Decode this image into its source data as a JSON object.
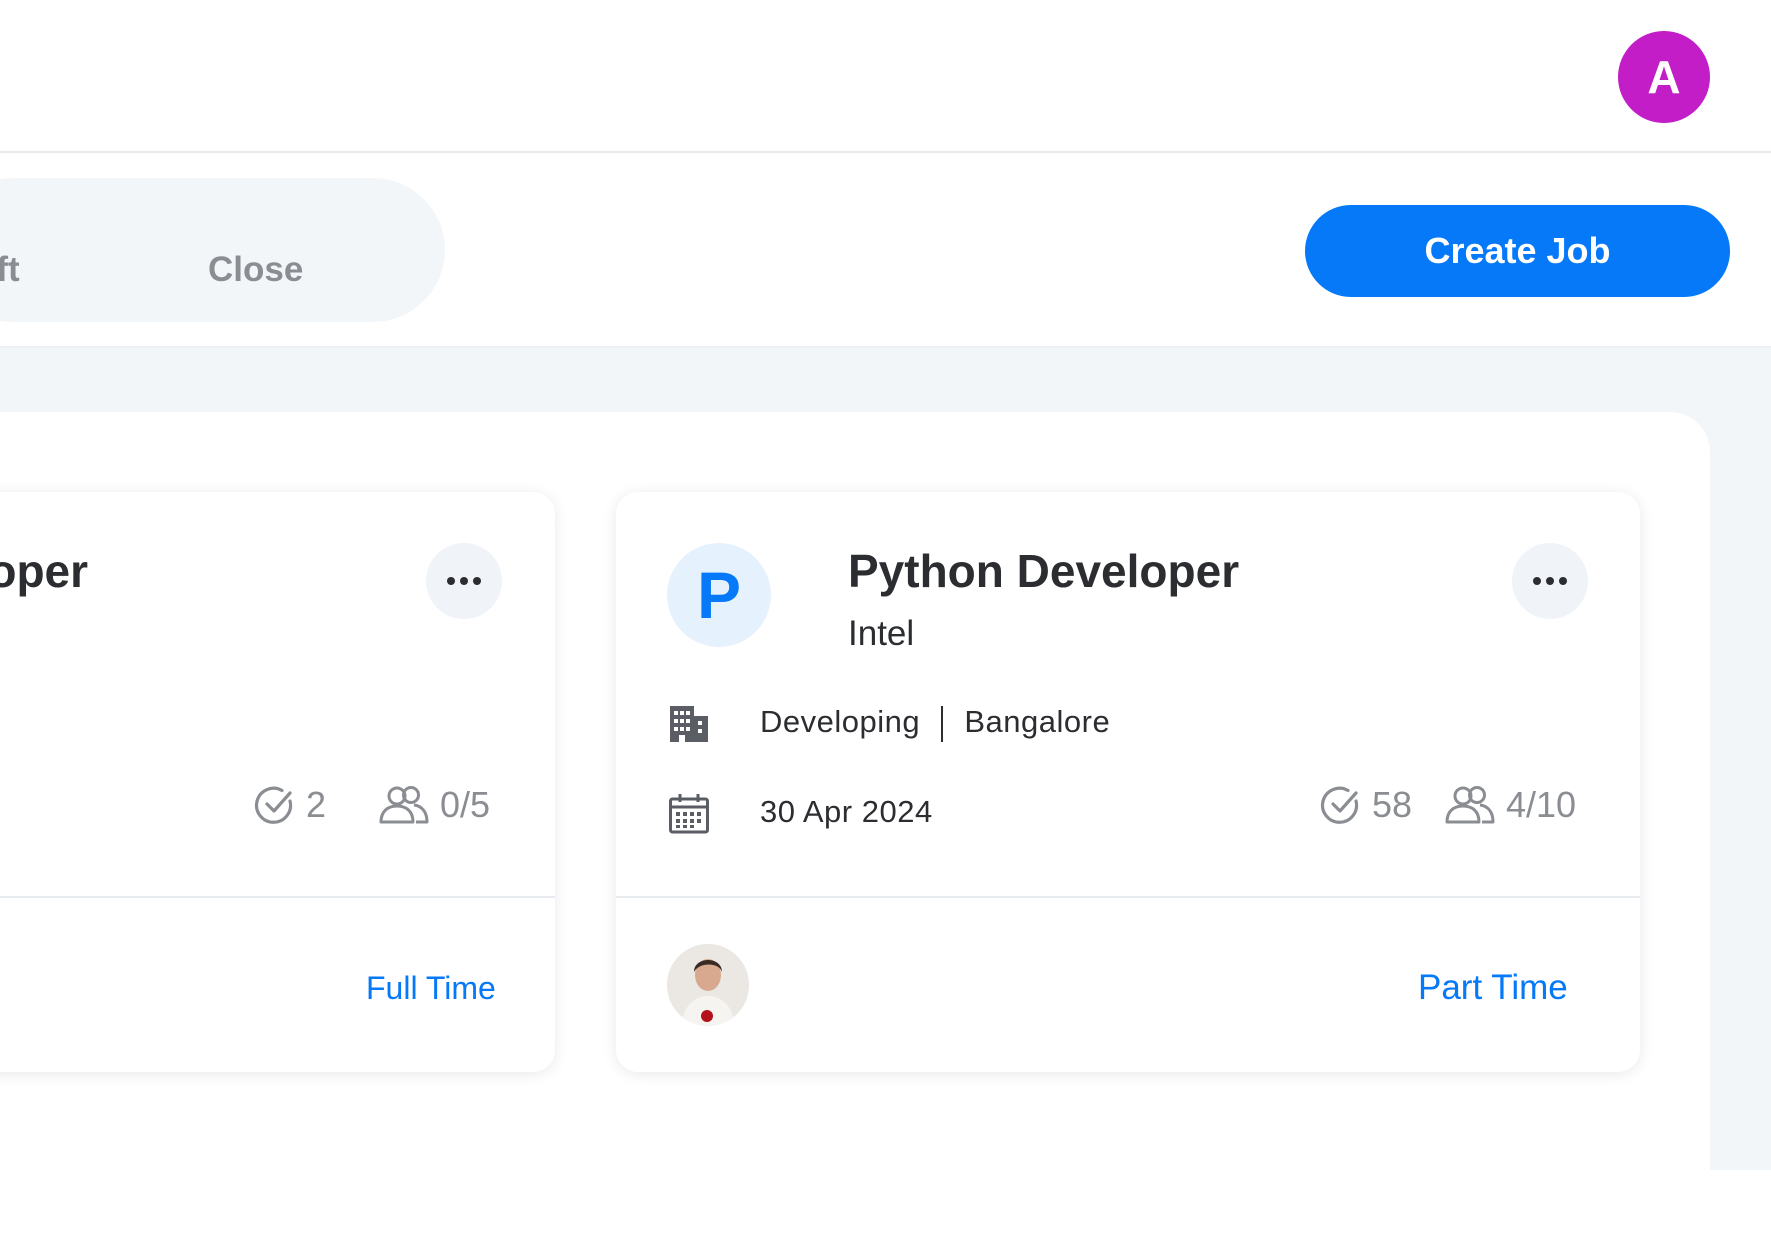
{
  "header": {
    "avatar_letter": "A",
    "avatar_color": "#c21dc6"
  },
  "tabs": {
    "draft_label": "Draft",
    "close_label": "Close"
  },
  "actions": {
    "create_job_label": "Create Job",
    "accent": "#0579f8"
  },
  "cards": [
    {
      "title": "eloper",
      "applied_count": "2",
      "hired": "0/5",
      "job_type": "Full Time"
    },
    {
      "logo_letter": "P",
      "title": "Python Developer",
      "company": "Intel",
      "department": "Developing",
      "location": "Bangalore",
      "date": "30 Apr 2024",
      "applied_count": "58",
      "hired": "4/10",
      "job_type": "Part Time"
    }
  ],
  "icons": {
    "building": "building-icon",
    "calendar": "calendar-icon",
    "check": "check-circle-icon",
    "people": "people-icon",
    "more": "more-dots-icon"
  }
}
